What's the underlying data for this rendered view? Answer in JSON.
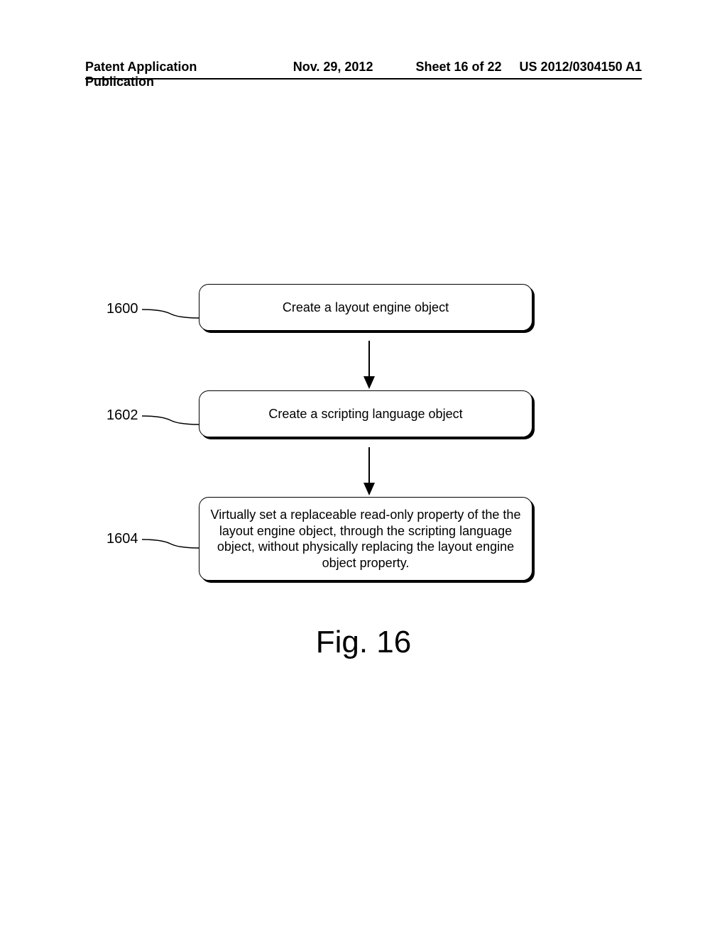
{
  "header": {
    "pub_label": "Patent Application Publication",
    "date": "Nov. 29, 2012",
    "sheet": "Sheet 16 of 22",
    "pub_number": "US 2012/0304150 A1"
  },
  "chart_data": {
    "type": "flowchart",
    "title": "Fig. 16",
    "nodes": [
      {
        "id": "1600",
        "label": "Create a layout engine object"
      },
      {
        "id": "1602",
        "label": "Create a scripting language object"
      },
      {
        "id": "1604",
        "label": "Virtually set a replaceable read-only property of the the layout engine object, through the scripting language object, without physically replacing the layout engine object property."
      }
    ],
    "edges": [
      {
        "from": "1600",
        "to": "1602",
        "style": "arrow"
      },
      {
        "from": "1602",
        "to": "1604",
        "style": "arrow"
      }
    ]
  },
  "figure_caption": "Fig. 16"
}
